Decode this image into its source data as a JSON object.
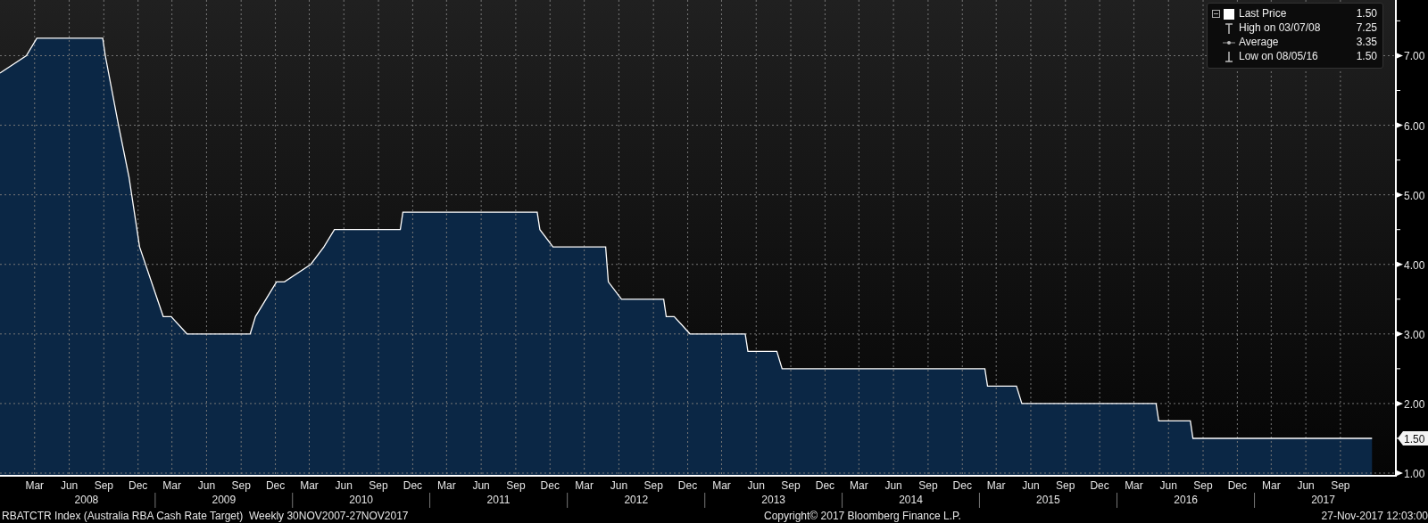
{
  "chart": {
    "chart_data": {
      "type": "area",
      "x": [
        "2007-11-30",
        "2008-02-08",
        "2008-03-07",
        "2008-08-29",
        "2008-09-05",
        "2008-10-10",
        "2008-11-07",
        "2008-12-05",
        "2009-02-06",
        "2009-02-27",
        "2009-04-10",
        "2009-09-25",
        "2009-10-09",
        "2009-11-06",
        "2009-12-04",
        "2009-12-25",
        "2010-03-05",
        "2010-04-09",
        "2010-05-07",
        "2010-10-29",
        "2010-11-05",
        "2011-10-28",
        "2011-11-04",
        "2011-12-09",
        "2012-04-27",
        "2012-05-04",
        "2012-06-08",
        "2012-09-28",
        "2012-10-05",
        "2012-10-26",
        "2012-12-07",
        "2013-05-03",
        "2013-05-10",
        "2013-07-26",
        "2013-08-09",
        "2015-01-30",
        "2015-02-06",
        "2015-04-24",
        "2015-05-08",
        "2016-04-29",
        "2016-05-06",
        "2016-07-29",
        "2016-08-05",
        "2017-11-24"
      ],
      "series": [
        {
          "name": "Last Price",
          "color": "#0b2745",
          "values": [
            6.75,
            7.0,
            7.25,
            7.25,
            7.0,
            6.0,
            5.25,
            4.25,
            3.25,
            3.25,
            3.0,
            3.0,
            3.25,
            3.5,
            3.75,
            3.75,
            4.0,
            4.25,
            4.5,
            4.5,
            4.75,
            4.75,
            4.5,
            4.25,
            4.25,
            3.75,
            3.5,
            3.5,
            3.25,
            3.25,
            3.0,
            3.0,
            2.75,
            2.75,
            2.5,
            2.5,
            2.25,
            2.25,
            2.0,
            2.0,
            1.75,
            1.75,
            1.5,
            1.5
          ]
        }
      ],
      "xlim": [
        "2007-11-30",
        "2018-01-24"
      ],
      "ylim": [
        1,
        7.8
      ],
      "yticks": [
        {
          "value": 1,
          "label": "1.00"
        },
        {
          "value": 2,
          "label": "2.00"
        },
        {
          "value": 3,
          "label": "3.00"
        },
        {
          "value": 4,
          "label": "4.00"
        },
        {
          "value": 5,
          "label": "5.00"
        },
        {
          "value": 6,
          "label": "6.00"
        },
        {
          "value": 7,
          "label": "7.00"
        }
      ],
      "xticks": [
        {
          "value": "2008-03-01",
          "label": "Mar"
        },
        {
          "value": "2008-06-01",
          "label": "Jun"
        },
        {
          "value": "2008-09-01",
          "label": "Sep"
        },
        {
          "value": "2008-12-01",
          "label": "Dec"
        },
        {
          "value": "2009-03-01",
          "label": "Mar"
        },
        {
          "value": "2009-06-01",
          "label": "Jun"
        },
        {
          "value": "2009-09-01",
          "label": "Sep"
        },
        {
          "value": "2009-12-01",
          "label": "Dec"
        },
        {
          "value": "2010-03-01",
          "label": "Mar"
        },
        {
          "value": "2010-06-01",
          "label": "Jun"
        },
        {
          "value": "2010-09-01",
          "label": "Sep"
        },
        {
          "value": "2010-12-01",
          "label": "Dec"
        },
        {
          "value": "2011-03-01",
          "label": "Mar"
        },
        {
          "value": "2011-06-01",
          "label": "Jun"
        },
        {
          "value": "2011-09-01",
          "label": "Sep"
        },
        {
          "value": "2011-12-01",
          "label": "Dec"
        },
        {
          "value": "2012-03-01",
          "label": "Mar"
        },
        {
          "value": "2012-06-01",
          "label": "Jun"
        },
        {
          "value": "2012-09-01",
          "label": "Sep"
        },
        {
          "value": "2012-12-01",
          "label": "Dec"
        },
        {
          "value": "2013-03-01",
          "label": "Mar"
        },
        {
          "value": "2013-06-01",
          "label": "Jun"
        },
        {
          "value": "2013-09-01",
          "label": "Sep"
        },
        {
          "value": "2013-12-01",
          "label": "Dec"
        },
        {
          "value": "2014-03-01",
          "label": "Mar"
        },
        {
          "value": "2014-06-01",
          "label": "Jun"
        },
        {
          "value": "2014-09-01",
          "label": "Sep"
        },
        {
          "value": "2014-12-01",
          "label": "Dec"
        },
        {
          "value": "2015-03-01",
          "label": "Mar"
        },
        {
          "value": "2015-06-01",
          "label": "Jun"
        },
        {
          "value": "2015-09-01",
          "label": "Sep"
        },
        {
          "value": "2015-12-01",
          "label": "Dec"
        },
        {
          "value": "2016-03-01",
          "label": "Mar"
        },
        {
          "value": "2016-06-01",
          "label": "Jun"
        },
        {
          "value": "2016-09-01",
          "label": "Sep"
        },
        {
          "value": "2016-12-01",
          "label": "Dec"
        },
        {
          "value": "2017-03-01",
          "label": "Mar"
        },
        {
          "value": "2017-06-01",
          "label": "Jun"
        },
        {
          "value": "2017-09-01",
          "label": "Sep"
        }
      ],
      "grid": true,
      "annotations": [
        "2008",
        "2009",
        "2010",
        "2011",
        "2012",
        "2013",
        "2014",
        "2015",
        "2016",
        "2017"
      ]
    },
    "last_price_tag": "1.50",
    "legend": [
      {
        "kind": "last",
        "value": "1.50"
      },
      {
        "kind": "high",
        "label": "High on 03/07/08",
        "value": "7.25"
      },
      {
        "kind": "average",
        "label": "Average",
        "value": "3.35"
      },
      {
        "kind": "low",
        "label": "Low on 08/05/16",
        "value": "1.50"
      }
    ]
  },
  "footer": {
    "description": "RBATCTR Index (Australia RBA Cash Rate Target)  Weekly 30NOV2007-27NOV2017",
    "copyright": "Copyright© 2017 Bloomberg Finance L.P.",
    "timestamp": "27-Nov-2017 12:03:00"
  }
}
